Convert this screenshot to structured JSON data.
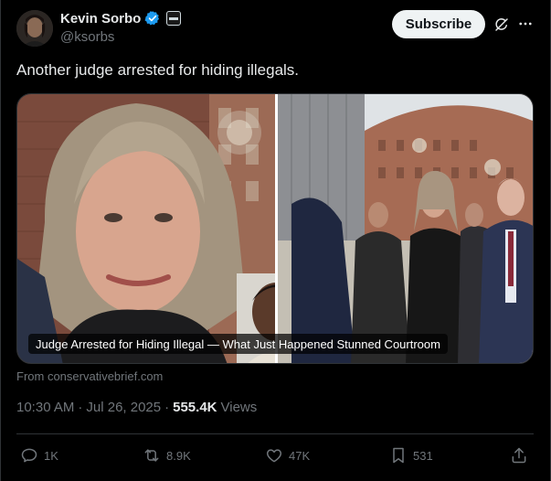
{
  "author": {
    "display_name": "Kevin Sorbo",
    "handle": "@ksorbs",
    "verified_icon": "verified-badge-icon",
    "affiliation_icon": "affiliation-badge-icon"
  },
  "header": {
    "subscribe_label": "Subscribe",
    "grok_icon": "grok-icon",
    "more_icon": "more-icon"
  },
  "tweet": {
    "text": "Another judge arrested for hiding illegals."
  },
  "media": {
    "caption": "Judge Arrested for Hiding Illegal — What Just Happened Stunned Courtroom"
  },
  "card": {
    "source": "From conservativebrief.com"
  },
  "meta": {
    "time": "10:30 AM",
    "separator": "·",
    "date": "Jul 26, 2025",
    "separator2": "·",
    "views_count": "555.4K",
    "views_label": "Views"
  },
  "actions": {
    "replies": "1K",
    "reposts": "8.9K",
    "likes": "47K",
    "bookmarks": "531"
  },
  "colors": {
    "background": "#000000",
    "text_primary": "#e7e9ea",
    "text_secondary": "#71767b",
    "verified_blue": "#1d9bf0",
    "subscribe_bg": "#eff3f4"
  }
}
